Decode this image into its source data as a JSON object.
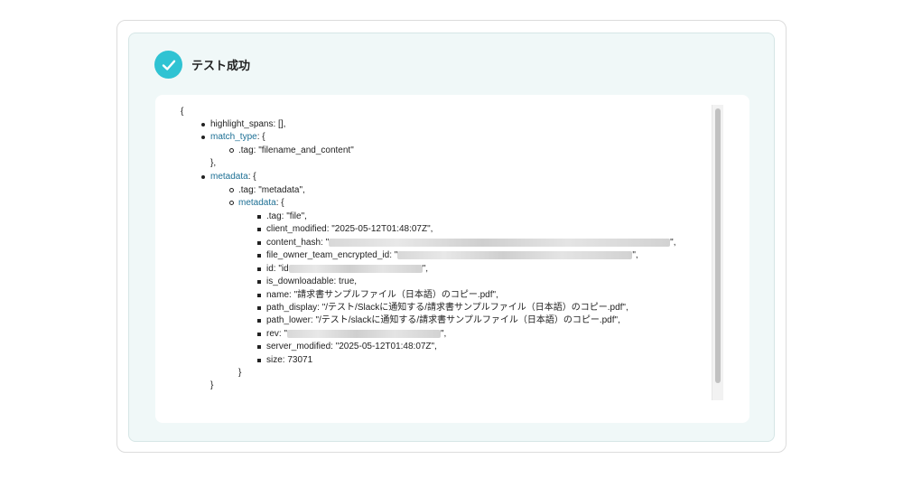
{
  "header": {
    "title": "テスト成功",
    "icon": "check-circle-icon",
    "accent": "#2fc3d3"
  },
  "code": {
    "open_brace": "{",
    "close_brace": "}",
    "highlight_spans": "highlight_spans: [],",
    "match_type_key": "match_type",
    "match_type_open": ": {",
    "match_tag": ".tag: \"filename_and_content\"",
    "match_close": "},",
    "metadata_key": "metadata",
    "metadata_open": ": {",
    "metadata_tag": ".tag: \"metadata\",",
    "inner_metadata_key": "metadata",
    "inner_metadata_open": ": {",
    "file_tag": ".tag: \"file\",",
    "client_modified": "client_modified: \"2025-05-12T01:48:07Z\",",
    "content_hash_prefix": "content_hash: \"",
    "content_hash_suffix": "\",",
    "owner_prefix": "file_owner_team_encrypted_id: \"",
    "owner_suffix": "\",",
    "id_prefix": "id: \"id",
    "id_suffix": "\",",
    "is_downloadable": "is_downloadable: true,",
    "name": "name: \"請求書サンプルファイル（日本語）のコピー.pdf\",",
    "path_display": "path_display: \"/テスト/Slackに通知する/請求書サンプルファイル（日本語）のコピー.pdf\",",
    "path_lower": "path_lower: \"/テスト/slackに通知する/請求書サンプルファイル（日本語）のコピー.pdf\",",
    "rev_prefix": "rev: \"",
    "rev_suffix": "\",",
    "server_modified": "server_modified: \"2025-05-12T01:48:07Z\",",
    "size": "size: 73071",
    "inner_close": "}",
    "outer_close": "}"
  }
}
